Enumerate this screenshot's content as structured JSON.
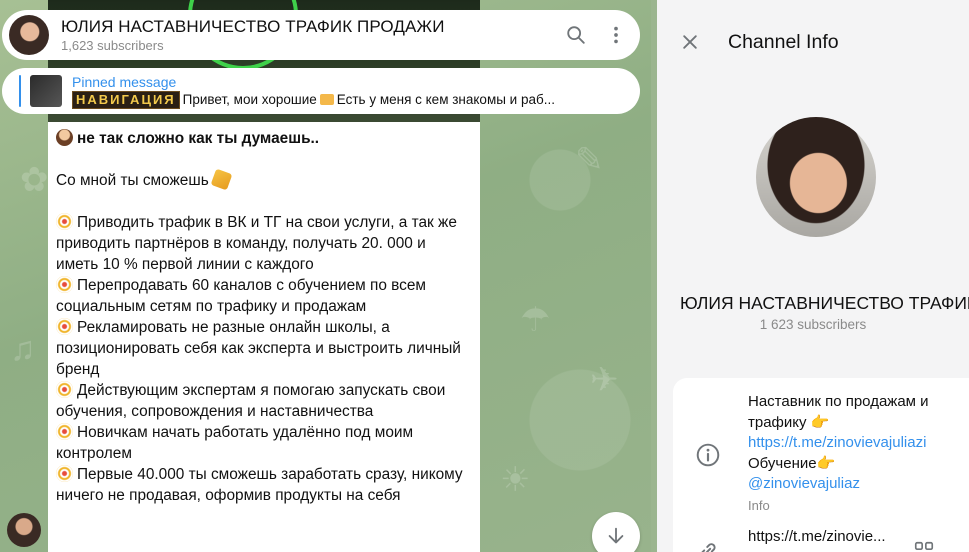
{
  "header": {
    "title": "ЮЛИЯ НАСТАВНИЧЕСТВО ТРАФИК ПРОДАЖИ",
    "subscribers": "1,623 subscribers"
  },
  "pinned": {
    "title": "Pinned message",
    "badge": "НАВИГАЦИЯ",
    "text_1": "Привет, мои хорошие",
    "text_2": "Есть у меня с кем знакомы и раб..."
  },
  "message": {
    "line_1": "не так сложно как ты думаешь..",
    "line_2": "Со мной ты сможешь",
    "items": [
      "Приводить трафик в ВК и ТГ на свои услуги, а так же приводить партнёров в команду, получать 20. 000 и иметь 10 % первой линии с каждого",
      "Перепродавать 60 каналов с обучением по всем социальным сетям по трафику и продажам",
      "Рекламировать не разные онлайн школы, а позиционировать себя как эксперта и выстроить личный бренд",
      "Действующим экспертам я помогаю запускать свои обучения, сопровождения и наставничества",
      "Новичкам начать работать удалённо под моим контролем",
      "Первые 40.000 ты сможешь заработать сразу, никому ничего не продавая, оформив продукты на себя"
    ]
  },
  "panel": {
    "title": "Channel Info",
    "name": "ЮЛИЯ НАСТАВНИЧЕСТВО ТРАФИК ПРОДАЖИ",
    "subscribers": "1 623 subscribers",
    "info": {
      "text_1": "Наставник по продажам и трафику",
      "link_1": "https://t.me/zinovievajuliazi",
      "text_2": "Обучение",
      "link_2": "@zinovievajuliaz",
      "label": "Info"
    },
    "link_row": "https://t.me/zinovie..."
  },
  "icons": {
    "search": "search-icon",
    "more": "more-vertical-icon",
    "close": "close-icon",
    "info": "info-icon",
    "link": "link-icon",
    "qr": "qr-code-icon",
    "scroll_down": "arrow-down-icon"
  },
  "colors": {
    "accent": "#3390ec",
    "chat_bg": "#9bb58f",
    "panel_bg": "#f4f4f5"
  }
}
